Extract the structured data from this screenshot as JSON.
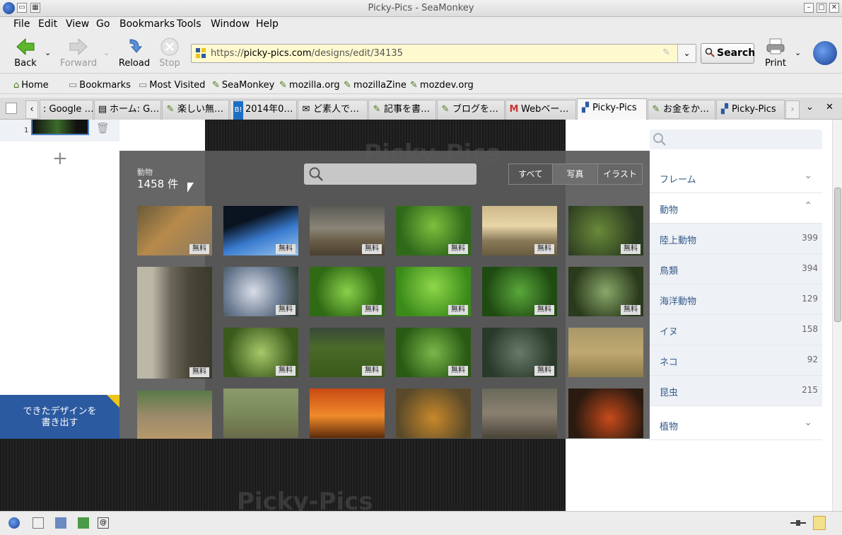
{
  "window": {
    "title": "Picky-Pics - SeaMonkey"
  },
  "menubar": {
    "items": [
      "File",
      "Edit",
      "View",
      "Go",
      "Bookmarks",
      "Tools",
      "Window",
      "Help"
    ]
  },
  "navbar": {
    "back_label": "Back",
    "forward_label": "Forward",
    "reload_label": "Reload",
    "stop_label": "Stop",
    "url_prefix": "https://",
    "url_host": "picky-pics.com",
    "url_path": "/designs/edit/34135",
    "search_label": "Search",
    "print_label": "Print"
  },
  "bookmarks": {
    "items": [
      "Home",
      "Bookmarks",
      "Most Visited",
      "SeaMonkey",
      "mozilla.org",
      "mozillaZine",
      "mozdev.org"
    ]
  },
  "tabs": {
    "items": [
      ": Google …",
      "ホーム: G…",
      "楽しい無…",
      "2014年0…",
      "ど素人で…",
      "記事を書…",
      "ブログを…",
      "Webベー…",
      "Picky-Pics",
      "お金をか…",
      "Picky-Pics"
    ],
    "active_index": 8
  },
  "editor": {
    "page_number": "1",
    "export_label_line1": "できたデザインを",
    "export_label_line2": "書き出す",
    "watermark": "Picky-Pics"
  },
  "picker": {
    "category": "動物",
    "count": "1458 件",
    "filters": [
      "すべて",
      "写真",
      "イラスト"
    ],
    "active_filter": 1,
    "free_label": "無料"
  },
  "sidebar": {
    "rows": [
      {
        "label": "フレーム",
        "chevron": "down"
      },
      {
        "label": "動物",
        "chevron": "up"
      },
      {
        "label": "陸上動物",
        "count": "399"
      },
      {
        "label": "鳥類",
        "count": "394"
      },
      {
        "label": "海洋動物",
        "count": "129"
      },
      {
        "label": "イヌ",
        "count": "158"
      },
      {
        "label": "ネコ",
        "count": "92"
      },
      {
        "label": "昆虫",
        "count": "215"
      },
      {
        "label": "植物",
        "chevron": "down"
      }
    ]
  },
  "colors": {
    "accent": "#2b5aa0",
    "sidebar_text": "#355a8a",
    "url_bg": "#fff9cf"
  }
}
